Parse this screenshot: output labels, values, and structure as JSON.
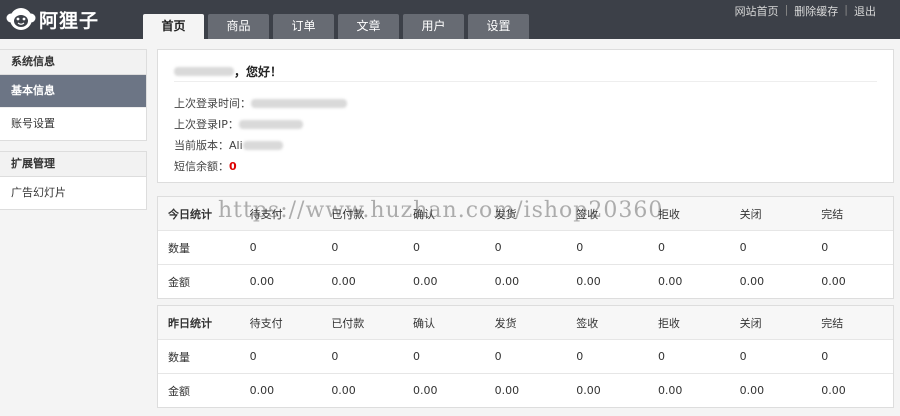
{
  "header": {
    "logo_text": "阿狸子",
    "tabs": [
      {
        "label": "首页",
        "active": true
      },
      {
        "label": "商品",
        "active": false
      },
      {
        "label": "订单",
        "active": false
      },
      {
        "label": "文章",
        "active": false
      },
      {
        "label": "用户",
        "active": false
      },
      {
        "label": "设置",
        "active": false
      }
    ],
    "links": [
      "网站首页",
      "删除缓存",
      "退出"
    ],
    "separator": "|"
  },
  "sidebar": {
    "groups": [
      {
        "title": "系统信息",
        "items": [
          {
            "label": "基本信息",
            "active": true
          },
          {
            "label": "账号设置",
            "active": false
          }
        ]
      },
      {
        "title": "扩展管理",
        "items": [
          {
            "label": "广告幻灯片",
            "active": false
          }
        ]
      }
    ]
  },
  "welcome": {
    "greeting_suffix": "，您好！",
    "last_login_time_label": "上次登录时间：",
    "last_login_ip_label": "上次登录IP：",
    "version_label": "当前版本：Ali",
    "sms_label": "短信余额：",
    "sms_value": "0"
  },
  "today_stats": {
    "headers": [
      "今日统计",
      "待支付",
      "已付款",
      "确认",
      "发货",
      "签收",
      "拒收",
      "关闭",
      "完结"
    ],
    "rows": [
      [
        "数量",
        "0",
        "0",
        "0",
        "0",
        "0",
        "0",
        "0",
        "0"
      ],
      [
        "金额",
        "0.00",
        "0.00",
        "0.00",
        "0.00",
        "0.00",
        "0.00",
        "0.00",
        "0.00"
      ]
    ]
  },
  "yesterday_stats": {
    "headers": [
      "昨日统计",
      "待支付",
      "已付款",
      "确认",
      "发货",
      "签收",
      "拒收",
      "关闭",
      "完结"
    ],
    "rows": [
      [
        "数量",
        "0",
        "0",
        "0",
        "0",
        "0",
        "0",
        "0",
        "0"
      ],
      [
        "金额",
        "0.00",
        "0.00",
        "0.00",
        "0.00",
        "0.00",
        "0.00",
        "0.00",
        "0.00"
      ]
    ]
  },
  "watermark": "https://www.huzhan.com/ishop20360",
  "colors": {
    "topbar": "#3c4048",
    "sidebar_active": "#6c7585",
    "paid": "#e07a0a",
    "confirm": "#1a5aa8",
    "ship": "#2b9a2b",
    "sign": "#d21b1b",
    "sms_value": "#dd0000"
  }
}
